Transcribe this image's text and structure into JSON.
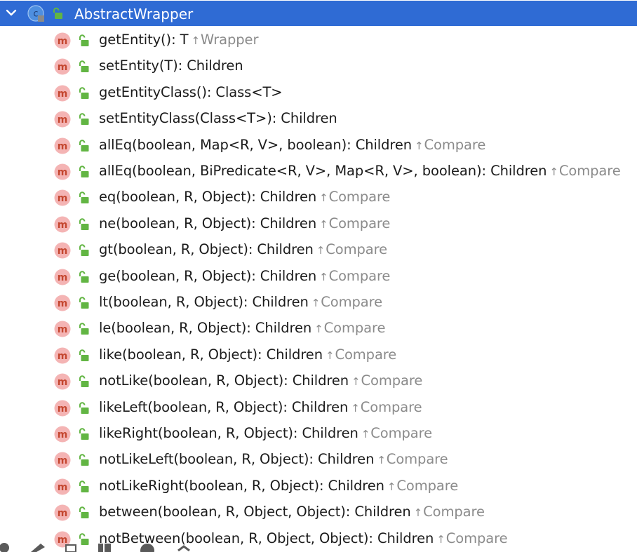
{
  "class_node": {
    "title": "AbstractWrapper",
    "expand_icon": "chevron-down-icon",
    "kind_icon": "class-icon",
    "visibility_icon": "unlock-icon",
    "kind_letter": "c"
  },
  "colors": {
    "selection": "#2f6bd4",
    "method_badge": "#f4b4b4",
    "method_letter": "#c4462f",
    "lock": "#62b543",
    "inherited": "#8b8b8b"
  },
  "method_letter": "m",
  "methods": [
    {
      "signature": "getEntity(): T",
      "override": "Wrapper"
    },
    {
      "signature": "setEntity(T): Children",
      "override": ""
    },
    {
      "signature": "getEntityClass(): Class<T>",
      "override": ""
    },
    {
      "signature": "setEntityClass(Class<T>): Children",
      "override": ""
    },
    {
      "signature": "allEq(boolean, Map<R, V>, boolean): Children",
      "override": "Compare"
    },
    {
      "signature": "allEq(boolean, BiPredicate<R, V>, Map<R, V>, boolean): Children",
      "override": "Compare"
    },
    {
      "signature": "eq(boolean, R, Object): Children",
      "override": "Compare"
    },
    {
      "signature": "ne(boolean, R, Object): Children",
      "override": "Compare"
    },
    {
      "signature": "gt(boolean, R, Object): Children",
      "override": "Compare"
    },
    {
      "signature": "ge(boolean, R, Object): Children",
      "override": "Compare"
    },
    {
      "signature": "lt(boolean, R, Object): Children",
      "override": "Compare"
    },
    {
      "signature": "le(boolean, R, Object): Children",
      "override": "Compare"
    },
    {
      "signature": "like(boolean, R, Object): Children",
      "override": "Compare"
    },
    {
      "signature": "notLike(boolean, R, Object): Children",
      "override": "Compare"
    },
    {
      "signature": "likeLeft(boolean, R, Object): Children",
      "override": "Compare"
    },
    {
      "signature": "likeRight(boolean, R, Object): Children",
      "override": "Compare"
    },
    {
      "signature": "notLikeLeft(boolean, R, Object): Children",
      "override": "Compare"
    },
    {
      "signature": "notLikeRight(boolean, R, Object): Children",
      "override": "Compare"
    },
    {
      "signature": "between(boolean, R, Object, Object): Children",
      "override": "Compare"
    },
    {
      "signature": "notBetween(boolean, R, Object, Object): Children",
      "override": "Compare"
    }
  ],
  "toolbar_icons": [
    "wrench-icon",
    "pencil-icon",
    "expand-icon",
    "columns-icon",
    "circle-icon",
    "checkmark-icon"
  ]
}
